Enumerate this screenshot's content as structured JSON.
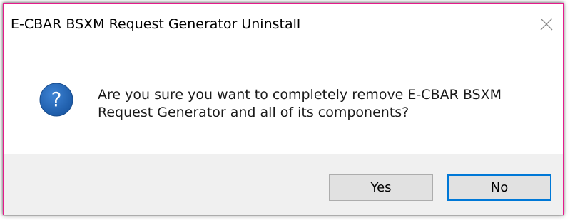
{
  "dialog": {
    "title": "E-CBAR BSXM Request Generator Uninstall",
    "message_line1": "Are you sure you want to completely remove E-CBAR BSXM",
    "message_line2": "Request Generator and all of its components?",
    "icon": "question-icon",
    "close_icon": "close-icon"
  },
  "buttons": {
    "yes_label": "Yes",
    "no_label": "No"
  },
  "colors": {
    "border_accent": "#e51a8c",
    "icon_blue": "#1c5fae",
    "default_button_border": "#0078d7",
    "footer_bg": "#f0f0f0"
  }
}
